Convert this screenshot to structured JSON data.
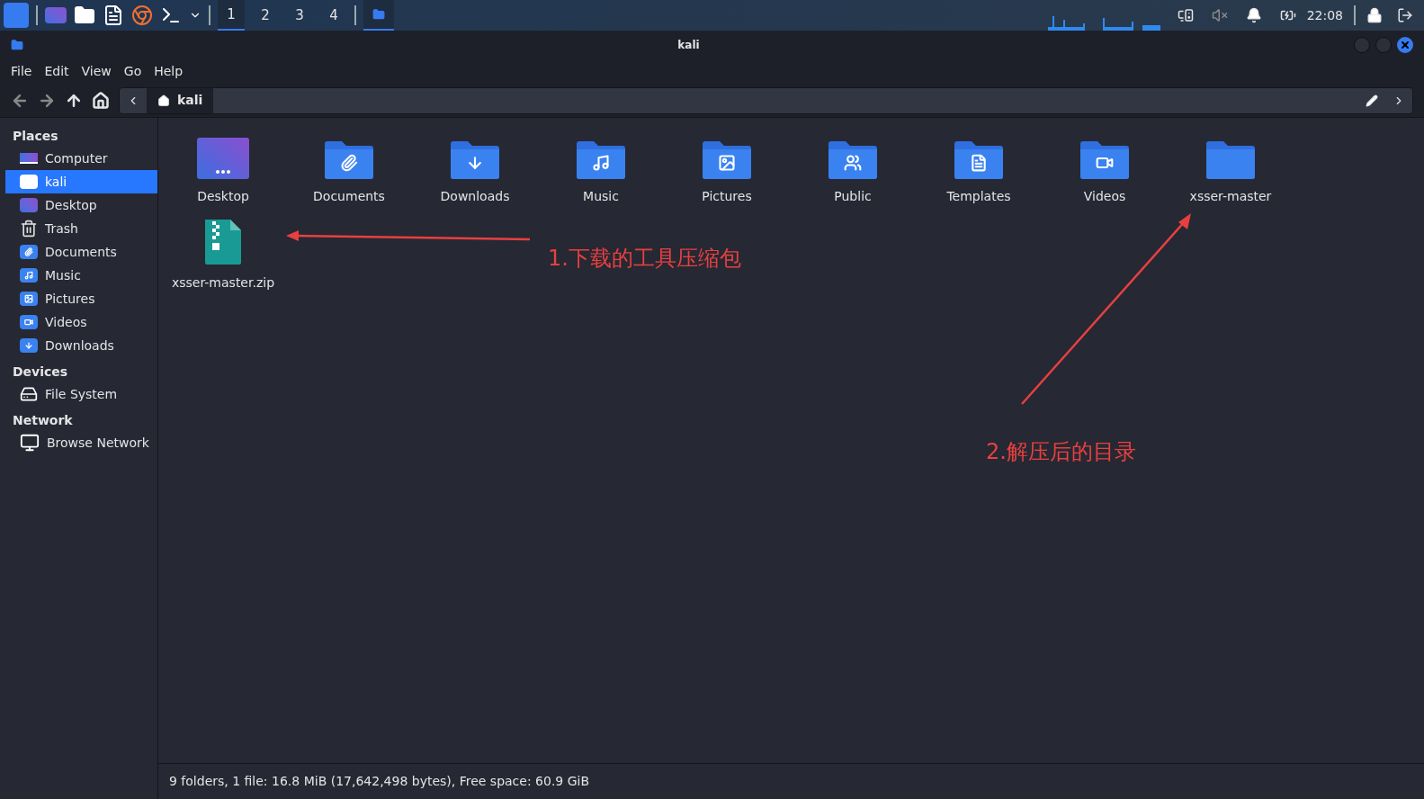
{
  "taskbar": {
    "workspaces": [
      {
        "label": "1",
        "selected": true
      },
      {
        "label": "2",
        "selected": false
      },
      {
        "label": "3",
        "selected": false
      },
      {
        "label": "4",
        "selected": false
      }
    ],
    "clock": "22:08"
  },
  "window": {
    "title": "kali"
  },
  "menu": [
    "File",
    "Edit",
    "View",
    "Go",
    "Help"
  ],
  "location": {
    "path": "kali"
  },
  "sidebar": [
    {
      "heading": "Places",
      "items": [
        {
          "label": "Computer",
          "kind": "computer",
          "selected": false
        },
        {
          "label": "kali",
          "kind": "home",
          "selected": true
        },
        {
          "label": "Desktop",
          "kind": "desktop",
          "selected": false
        },
        {
          "label": "Trash",
          "kind": "trash",
          "selected": false
        },
        {
          "label": "Documents",
          "kind": "documents",
          "selected": false
        },
        {
          "label": "Music",
          "kind": "music",
          "selected": false
        },
        {
          "label": "Pictures",
          "kind": "pictures",
          "selected": false
        },
        {
          "label": "Videos",
          "kind": "videos",
          "selected": false
        },
        {
          "label": "Downloads",
          "kind": "downloads",
          "selected": false
        }
      ]
    },
    {
      "heading": "Devices",
      "items": [
        {
          "label": "File System",
          "kind": "drive",
          "selected": false
        }
      ]
    },
    {
      "heading": "Network",
      "items": [
        {
          "label": "Browse Network",
          "kind": "network",
          "selected": false
        }
      ]
    }
  ],
  "files": [
    {
      "name": "Desktop",
      "kind": "desktop"
    },
    {
      "name": "Documents",
      "kind": "documents"
    },
    {
      "name": "Downloads",
      "kind": "downloads"
    },
    {
      "name": "Music",
      "kind": "music"
    },
    {
      "name": "Pictures",
      "kind": "pictures"
    },
    {
      "name": "Public",
      "kind": "public"
    },
    {
      "name": "Templates",
      "kind": "templates"
    },
    {
      "name": "Videos",
      "kind": "videos"
    },
    {
      "name": "xsser-master",
      "kind": "folder"
    },
    {
      "name": "xsser-master.zip",
      "kind": "archive"
    }
  ],
  "annotations": [
    {
      "text": "1.下载的工具压缩包"
    },
    {
      "text": "2.解压后的目录"
    }
  ],
  "status_bar": "9 folders, 1 file: 16.8 MiB (17,642,498 bytes), Free space: 60.9 GiB"
}
